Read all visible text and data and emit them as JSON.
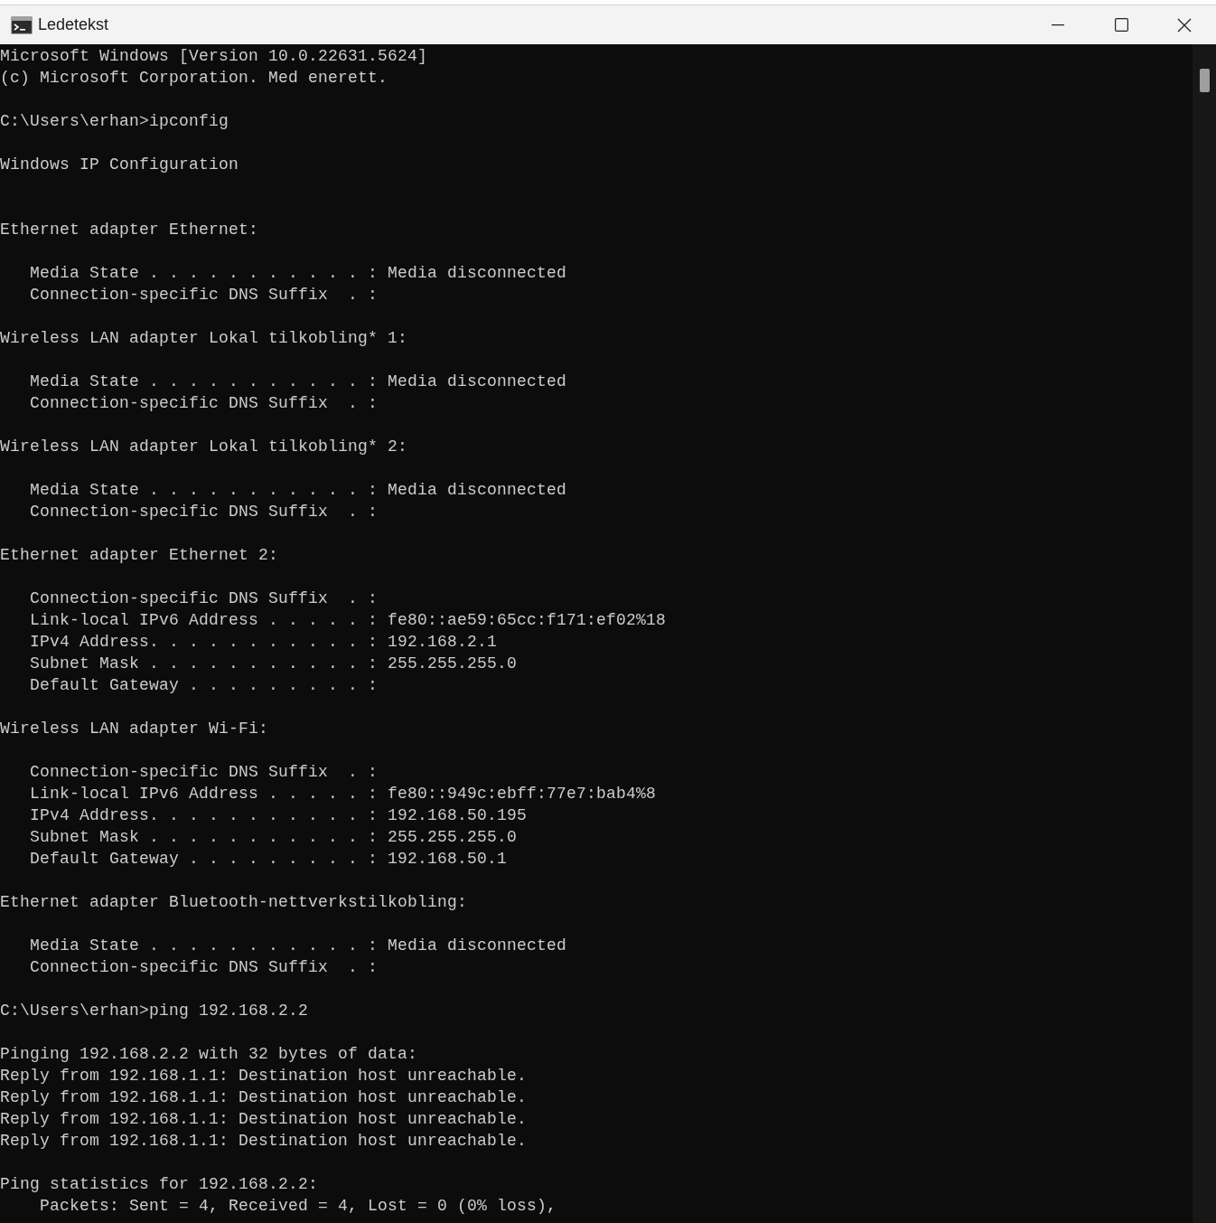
{
  "window": {
    "title": "Ledetekst"
  },
  "console": {
    "lines": [
      {
        "kind": "text",
        "text": "Microsoft Windows [Version 10.0.22631.5624]"
      },
      {
        "kind": "text",
        "text": "(c) Microsoft Corporation. Med enerett."
      },
      {
        "kind": "blank"
      },
      {
        "kind": "text",
        "text": "C:\\Users\\erhan>ipconfig"
      },
      {
        "kind": "blank"
      },
      {
        "kind": "text",
        "text": "Windows IP Configuration"
      },
      {
        "kind": "blank"
      },
      {
        "kind": "blank"
      },
      {
        "kind": "text",
        "text": "Ethernet adapter Ethernet:"
      },
      {
        "kind": "blank"
      },
      {
        "kind": "text",
        "text": "   Media State . . . . . . . . . . . : Media disconnected"
      },
      {
        "kind": "text",
        "text": "   Connection-specific DNS Suffix  . :"
      },
      {
        "kind": "blank"
      },
      {
        "kind": "text",
        "text": "Wireless LAN adapter Lokal tilkobling* 1:"
      },
      {
        "kind": "blank"
      },
      {
        "kind": "text",
        "text": "   Media State . . . . . . . . . . . : Media disconnected"
      },
      {
        "kind": "text",
        "text": "   Connection-specific DNS Suffix  . :"
      },
      {
        "kind": "blank"
      },
      {
        "kind": "text",
        "text": "Wireless LAN adapter Lokal tilkobling* 2:"
      },
      {
        "kind": "blank"
      },
      {
        "kind": "text",
        "text": "   Media State . . . . . . . . . . . : Media disconnected"
      },
      {
        "kind": "text",
        "text": "   Connection-specific DNS Suffix  . :"
      },
      {
        "kind": "blank"
      },
      {
        "kind": "text",
        "text": "Ethernet adapter Ethernet 2:"
      },
      {
        "kind": "blank"
      },
      {
        "kind": "text",
        "text": "   Connection-specific DNS Suffix  . :"
      },
      {
        "kind": "text",
        "text": "   Link-local IPv6 Address . . . . . : fe80::ae59:65cc:f171:ef02%18"
      },
      {
        "kind": "text",
        "text": "   IPv4 Address. . . . . . . . . . . : 192.168.2.1"
      },
      {
        "kind": "text",
        "text": "   Subnet Mask . . . . . . . . . . . : 255.255.255.0"
      },
      {
        "kind": "text",
        "text": "   Default Gateway . . . . . . . . . :"
      },
      {
        "kind": "blank"
      },
      {
        "kind": "text",
        "text": "Wireless LAN adapter Wi-Fi:"
      },
      {
        "kind": "blank"
      },
      {
        "kind": "text",
        "text": "   Connection-specific DNS Suffix  . :"
      },
      {
        "kind": "text",
        "text": "   Link-local IPv6 Address . . . . . : fe80::949c:ebff:77e7:bab4%8"
      },
      {
        "kind": "text",
        "text": "   IPv4 Address. . . . . . . . . . . : 192.168.50.195"
      },
      {
        "kind": "text",
        "text": "   Subnet Mask . . . . . . . . . . . : 255.255.255.0"
      },
      {
        "kind": "text",
        "text": "   Default Gateway . . . . . . . . . : 192.168.50.1"
      },
      {
        "kind": "blank"
      },
      {
        "kind": "text",
        "text": "Ethernet adapter Bluetooth-nettverkstilkobling:"
      },
      {
        "kind": "blank"
      },
      {
        "kind": "text",
        "text": "   Media State . . . . . . . . . . . : Media disconnected"
      },
      {
        "kind": "text",
        "text": "   Connection-specific DNS Suffix  . :"
      },
      {
        "kind": "blank"
      },
      {
        "kind": "text",
        "text": "C:\\Users\\erhan>ping 192.168.2.2"
      },
      {
        "kind": "blank"
      },
      {
        "kind": "text",
        "text": "Pinging 192.168.2.2 with 32 bytes of data:"
      },
      {
        "kind": "text",
        "text": "Reply from 192.168.1.1: Destination host unreachable."
      },
      {
        "kind": "text",
        "text": "Reply from 192.168.1.1: Destination host unreachable."
      },
      {
        "kind": "text",
        "text": "Reply from 192.168.1.1: Destination host unreachable."
      },
      {
        "kind": "text",
        "text": "Reply from 192.168.1.1: Destination host unreachable."
      },
      {
        "kind": "blank"
      },
      {
        "kind": "text",
        "text": "Ping statistics for 192.168.2.2:"
      },
      {
        "kind": "text",
        "text": "    Packets: Sent = 4, Received = 4, Lost = 0 (0% loss),"
      }
    ]
  }
}
